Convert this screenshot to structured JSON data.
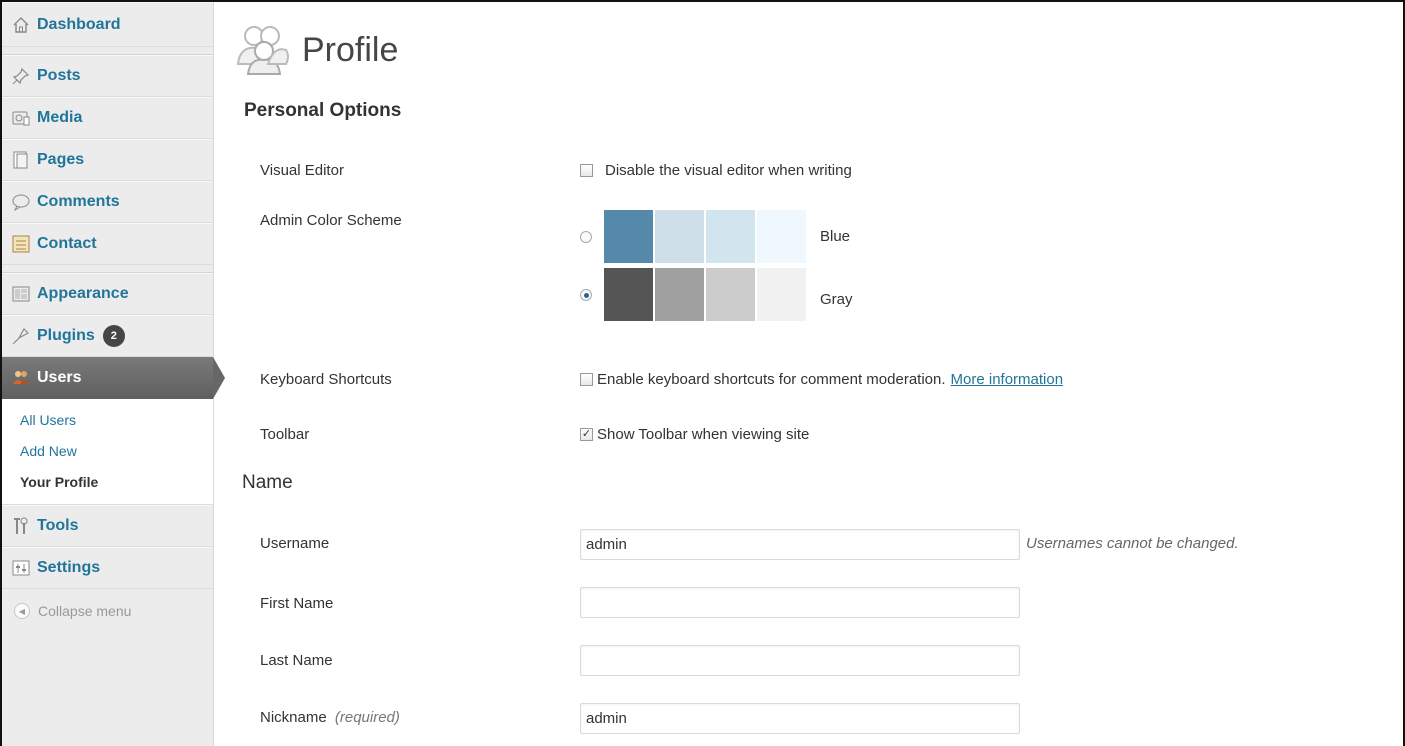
{
  "sidebar": {
    "items": [
      {
        "label": "Dashboard",
        "icon": "dashboard-icon"
      },
      {
        "label": "Posts",
        "icon": "pushpin-icon"
      },
      {
        "label": "Media",
        "icon": "media-icon"
      },
      {
        "label": "Pages",
        "icon": "pages-icon"
      },
      {
        "label": "Comments",
        "icon": "comments-icon"
      },
      {
        "label": "Contact",
        "icon": "contact-icon"
      },
      {
        "label": "Appearance",
        "icon": "appearance-icon"
      },
      {
        "label": "Plugins",
        "icon": "plugins-icon",
        "badge": "2"
      },
      {
        "label": "Users",
        "icon": "users-icon"
      },
      {
        "label": "Tools",
        "icon": "tools-icon"
      },
      {
        "label": "Settings",
        "icon": "settings-icon"
      }
    ],
    "submenu": [
      "All Users",
      "Add New",
      "Your Profile"
    ],
    "collapse_label": "Collapse menu"
  },
  "page": {
    "title": "Profile",
    "personal_options": {
      "heading": "Personal Options",
      "visual_editor_label": "Visual Editor",
      "visual_editor_text": "Disable the visual editor when writing",
      "visual_editor_checked": false,
      "color_scheme_label": "Admin Color Scheme",
      "schemes": [
        {
          "name": "Blue",
          "selected": false,
          "colors": [
            "#5589aa",
            "#cfdfe9",
            "#d1e5ee",
            "#eff8ff"
          ]
        },
        {
          "name": "Gray",
          "selected": true,
          "colors": [
            "#555555",
            "#a0a0a0",
            "#cccccc",
            "#f1f1f1"
          ]
        }
      ],
      "shortcuts_label": "Keyboard Shortcuts",
      "shortcuts_text": "Enable keyboard shortcuts for comment moderation.",
      "shortcuts_link": "More information",
      "shortcuts_checked": false,
      "toolbar_label": "Toolbar",
      "toolbar_text": "Show Toolbar when viewing site",
      "toolbar_checked": true
    },
    "name": {
      "heading": "Name",
      "username_label": "Username",
      "username_value": "admin",
      "username_note": "Usernames cannot be changed.",
      "first_name_label": "First Name",
      "first_name_value": "",
      "last_name_label": "Last Name",
      "last_name_value": "",
      "nickname_label": "Nickname",
      "nickname_required": "(required)",
      "nickname_value": "admin"
    }
  }
}
